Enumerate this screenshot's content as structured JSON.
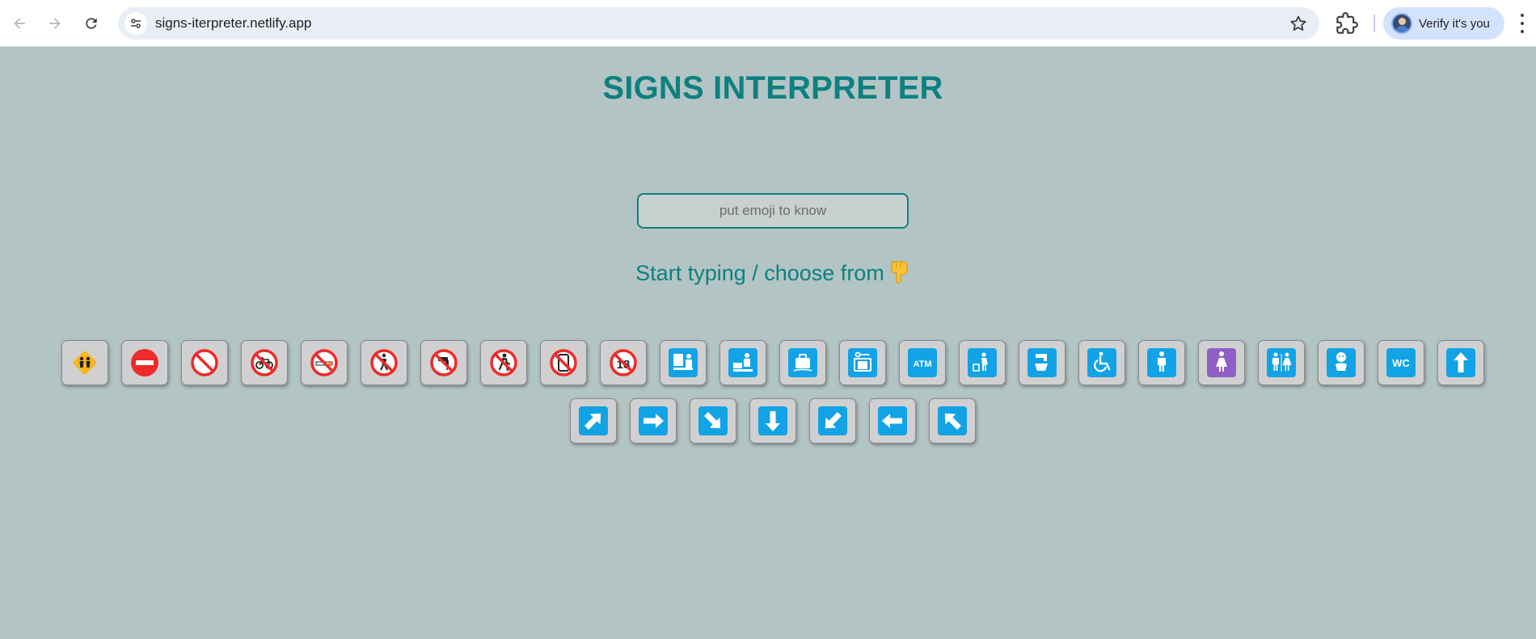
{
  "browser": {
    "url": "signs-iterpreter.netlify.app",
    "profile_label": "Verify it's you"
  },
  "page": {
    "title": "SIGNS INTERPRETER",
    "search_placeholder": "put emoji to know",
    "hint": "Start typing / choose from"
  },
  "emojis": [
    {
      "char": "🚸",
      "name": "children-crossing",
      "kind": "diamond",
      "glyph": "children"
    },
    {
      "char": "⛔",
      "name": "no-entry",
      "kind": "noentry",
      "glyph": ""
    },
    {
      "char": "🚫",
      "name": "prohibited",
      "kind": "prohibit",
      "glyph": ""
    },
    {
      "char": "🚳",
      "name": "no-bicycles",
      "kind": "prohibit",
      "glyph": "bicycle"
    },
    {
      "char": "🚭",
      "name": "no-smoking",
      "kind": "prohibit",
      "glyph": "cigarette"
    },
    {
      "char": "🚯",
      "name": "no-littering",
      "kind": "prohibit",
      "glyph": "litter"
    },
    {
      "char": "🚱",
      "name": "non-potable-water",
      "kind": "prohibit",
      "glyph": "tap"
    },
    {
      "char": "🚷",
      "name": "no-pedestrians",
      "kind": "prohibit",
      "glyph": "walker"
    },
    {
      "char": "📵",
      "name": "no-mobile-phones",
      "kind": "prohibit",
      "glyph": "phone"
    },
    {
      "char": "🔞",
      "name": "no-one-under-eighteen",
      "kind": "prohibit",
      "glyph": "18"
    },
    {
      "char": "🛂",
      "name": "passport-control",
      "kind": "blue",
      "glyph": "passport"
    },
    {
      "char": "🛃",
      "name": "customs",
      "kind": "blue",
      "glyph": "customs"
    },
    {
      "char": "🛄",
      "name": "baggage-claim",
      "kind": "blue",
      "glyph": "bag"
    },
    {
      "char": "🛅",
      "name": "left-luggage",
      "kind": "blue",
      "glyph": "locker"
    },
    {
      "char": "🏧",
      "name": "atm-sign",
      "kind": "blue",
      "glyph": "ATM"
    },
    {
      "char": "🚮",
      "name": "litter-in-bin",
      "kind": "blue",
      "glyph": "bin"
    },
    {
      "char": "🚰",
      "name": "potable-water",
      "kind": "blue",
      "glyph": "water"
    },
    {
      "char": "♿",
      "name": "wheelchair-symbol",
      "kind": "blue",
      "glyph": "wheelchair"
    },
    {
      "char": "🚹",
      "name": "mens-room",
      "kind": "blue",
      "glyph": "man"
    },
    {
      "char": "🚺",
      "name": "womens-room",
      "kind": "purple",
      "glyph": "woman"
    },
    {
      "char": "🚻",
      "name": "restroom",
      "kind": "blue",
      "glyph": "restroom"
    },
    {
      "char": "🚼",
      "name": "baby-symbol",
      "kind": "blue",
      "glyph": "baby"
    },
    {
      "char": "🚾",
      "name": "water-closet",
      "kind": "blue",
      "glyph": "WC"
    },
    {
      "char": "⬆️",
      "name": "up-arrow",
      "kind": "arrow",
      "glyph": "0"
    },
    {
      "char": "↗️",
      "name": "up-right-arrow",
      "kind": "arrow",
      "glyph": "45"
    },
    {
      "char": "➡️",
      "name": "right-arrow",
      "kind": "arrow",
      "glyph": "90"
    },
    {
      "char": "↘️",
      "name": "down-right-arrow",
      "kind": "arrow",
      "glyph": "135"
    },
    {
      "char": "⬇️",
      "name": "down-arrow",
      "kind": "arrow",
      "glyph": "180"
    },
    {
      "char": "↙️",
      "name": "down-left-arrow",
      "kind": "arrow",
      "glyph": "225"
    },
    {
      "char": "⬅️",
      "name": "left-arrow",
      "kind": "arrow",
      "glyph": "270"
    },
    {
      "char": "↖️",
      "name": "up-left-arrow",
      "kind": "arrow",
      "glyph": "315"
    }
  ],
  "colors": {
    "background": "#b3c4c4",
    "accent": "#0e8080",
    "sign_blue": "#12a3e6",
    "sign_purple": "#8f5fc7",
    "sign_red": "#ee2a2a",
    "sign_yellow": "#f7b51e"
  }
}
